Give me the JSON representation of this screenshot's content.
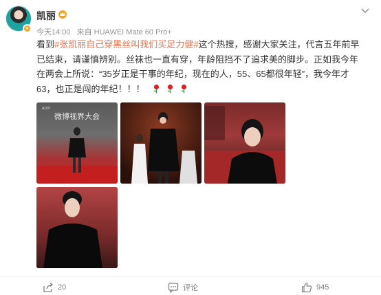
{
  "post": {
    "username": "凯丽",
    "time": "今天14:00",
    "source": "来自 HUAWEI Mate 60 Pro+",
    "text_part1": "看到",
    "hashtag": "#张凯丽自己穿黑丝叫我们买足力健#",
    "text_part2": "这个热搜，感谢大家关注，代言五年前早已结束，请谨慎辨别。丝袜也一直有穿，年龄阻挡不了追求美的脚步。正如我今年在两会上所说：“35岁正是干事的年纪，现在的人，55、65都很年轻”，我今年才63，也正是闯的年纪！！！"
  },
  "photos": {
    "p1_title": "微博视界大会",
    "p1_brand": "AUDI"
  },
  "actions": {
    "share_count": "20",
    "comment_label": "评论",
    "like_count": "945"
  },
  "icons": {
    "crown": "crown-icon",
    "rose": "rose-icon",
    "share": "share-icon",
    "comment": "comment-icon",
    "like": "like-icon",
    "more": "chevron-down-icon"
  },
  "colors": {
    "hashtag": "#eb7350",
    "crown": "#f7a21b"
  }
}
